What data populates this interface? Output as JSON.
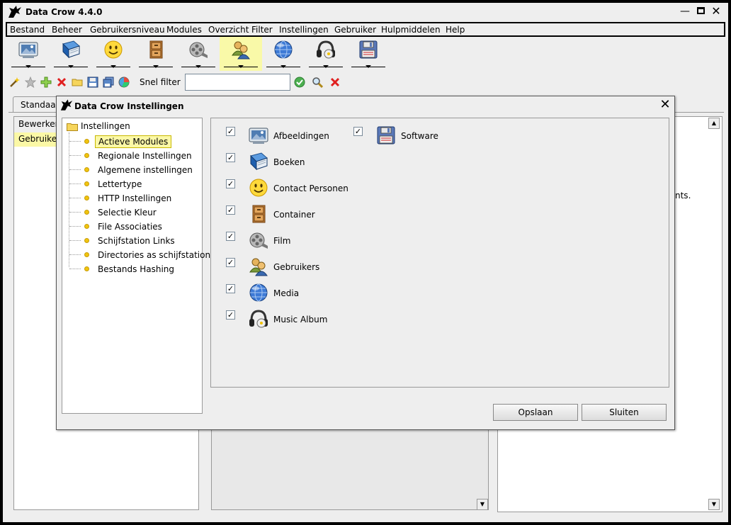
{
  "app": {
    "title": "Data Crow 4.4.0"
  },
  "window_controls": {
    "minimize": "—",
    "close": "✕"
  },
  "menubar": [
    "Bestand",
    "Beheer",
    "Gebruikersniveau",
    "Modules",
    "Overzicht",
    "Filter",
    "Instellingen",
    "Gebruiker",
    "Hulpmiddelen",
    "Help"
  ],
  "module_toolbar": [
    {
      "icon": "picture-icon",
      "active": false
    },
    {
      "icon": "book-icon",
      "active": false
    },
    {
      "icon": "smiley-icon",
      "active": false
    },
    {
      "icon": "container-icon",
      "active": false
    },
    {
      "icon": "film-reel-icon",
      "active": false
    },
    {
      "icon": "users-icon",
      "active": true
    },
    {
      "icon": "globe-icon",
      "active": false
    },
    {
      "icon": "headphones-icon",
      "active": false
    },
    {
      "icon": "floppy-disk-icon",
      "active": false
    }
  ],
  "action_toolbar": {
    "icons": [
      "wand-icon",
      "star-icon",
      "add-icon",
      "delete-icon",
      "folder-icon",
      "save-icon",
      "save-all-icon",
      "chart-icon"
    ],
    "quick_filter_label": "Snel filter",
    "quick_filter_value": "",
    "filter_icons": [
      "apply-filter-icon",
      "search-icon",
      "clear-filter-icon"
    ]
  },
  "background": {
    "tab_label": "Standaard",
    "left_header": "Bewerken",
    "left_selected_row": "Gebruikers",
    "right_text_fragment": "nts.",
    "scroll_up": "▲",
    "scroll_down": "▼"
  },
  "dialog": {
    "title": "Data Crow Instellingen",
    "close": "✕",
    "tree": {
      "root": "Instellingen",
      "items": [
        {
          "label": "Actieve Modules",
          "selected": true
        },
        {
          "label": "Regionale Instellingen",
          "selected": false
        },
        {
          "label": "Algemene instellingen",
          "selected": false
        },
        {
          "label": "Lettertype",
          "selected": false
        },
        {
          "label": "HTTP Instellingen",
          "selected": false
        },
        {
          "label": "Selectie Kleur",
          "selected": false
        },
        {
          "label": "File Associaties",
          "selected": false
        },
        {
          "label": "Schijfstation Links",
          "selected": false
        },
        {
          "label": "Directories as schijfstation",
          "selected": false
        },
        {
          "label": "Bestands Hashing",
          "selected": false
        }
      ]
    },
    "modules": [
      {
        "label": "Afbeeldingen",
        "checked": true,
        "icon": "picture-icon"
      },
      {
        "label": "Boeken",
        "checked": true,
        "icon": "book-icon"
      },
      {
        "label": "Contact Personen",
        "checked": true,
        "icon": "smiley-icon"
      },
      {
        "label": "Container",
        "checked": true,
        "icon": "container-icon"
      },
      {
        "label": "Film",
        "checked": true,
        "icon": "film-reel-icon"
      },
      {
        "label": "Gebruikers",
        "checked": true,
        "icon": "users-icon"
      },
      {
        "label": "Media",
        "checked": true,
        "icon": "globe-icon"
      },
      {
        "label": "Music Album",
        "checked": true,
        "icon": "headphones-icon"
      },
      {
        "label": "Software",
        "checked": true,
        "icon": "floppy-disk-icon"
      }
    ],
    "buttons": {
      "save": "Opslaan",
      "close": "Sluiten"
    }
  },
  "colors": {
    "selection_yellow": "#fbf8a6",
    "active_module_bg": "#f9f9a8",
    "window_bg": "#eeeeee"
  }
}
